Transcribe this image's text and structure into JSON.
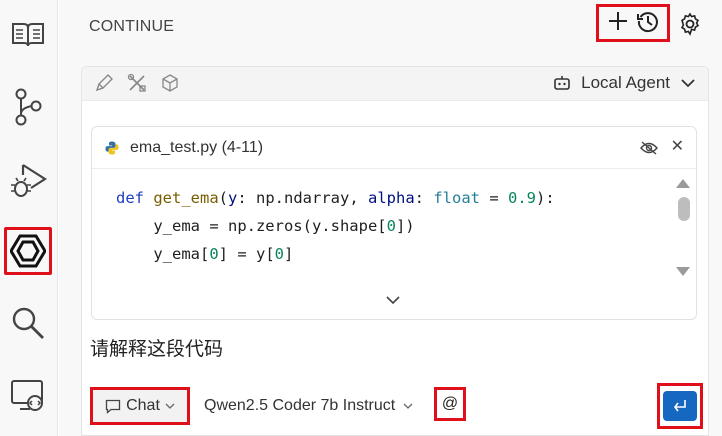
{
  "panel": {
    "title": "CONTINUE"
  },
  "toolbar": {
    "agent_label": "Local Agent"
  },
  "snippet": {
    "filename": "ema_test.py (4-11)",
    "code": [
      [
        {
          "t": "def ",
          "c": "kw"
        },
        {
          "t": "get_ema",
          "c": "fn"
        },
        {
          "t": "(",
          "c": ""
        },
        {
          "t": "y",
          "c": "pa"
        },
        {
          "t": ": np.ndarray, ",
          "c": ""
        },
        {
          "t": "alpha",
          "c": "pa"
        },
        {
          "t": ": ",
          "c": ""
        },
        {
          "t": "float",
          "c": "ty"
        },
        {
          "t": " = ",
          "c": ""
        },
        {
          "t": "0.9",
          "c": "nu"
        },
        {
          "t": "):",
          "c": ""
        }
      ],
      [
        {
          "t": "    y_ema = np.zeros(y.shape[",
          "c": ""
        },
        {
          "t": "0",
          "c": "nu"
        },
        {
          "t": "])",
          "c": ""
        }
      ],
      [
        {
          "t": "    y_ema[",
          "c": ""
        },
        {
          "t": "0",
          "c": "nu"
        },
        {
          "t": "] = y[",
          "c": ""
        },
        {
          "t": "0",
          "c": "nu"
        },
        {
          "t": "]",
          "c": ""
        }
      ]
    ]
  },
  "input": {
    "prompt": "请解释这段代码"
  },
  "footer": {
    "mode_label": "Chat",
    "model_label": "Qwen2.5 Coder 7b Instruct",
    "at_label": "@"
  },
  "colors": {
    "highlight": "#e0101a",
    "send": "#1567c0"
  }
}
